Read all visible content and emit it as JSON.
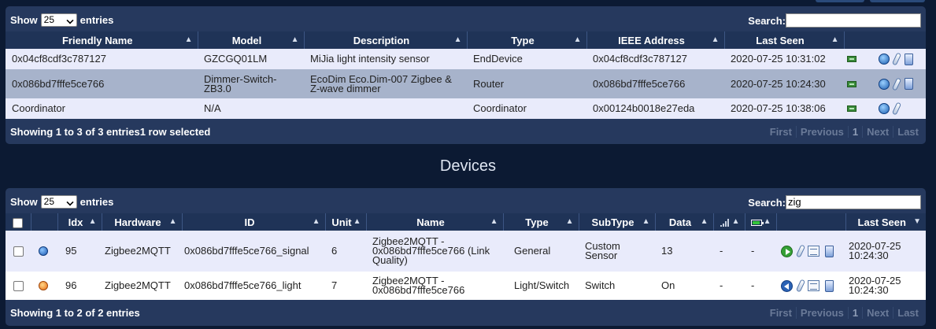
{
  "nodes_table": {
    "show_label": "Show",
    "entries_value": "25",
    "entries_label": "entries",
    "search_label": "Search:",
    "search_value": "",
    "columns": [
      "Friendly Name",
      "Model",
      "Description",
      "Type",
      "IEEE Address",
      "Last Seen"
    ],
    "rows": [
      {
        "friendly_name": "0x04cf8cdf3c787127",
        "model": "GZCGQ01LM",
        "description": "MiJia light intensity sensor",
        "type": "EndDevice",
        "ieee": "0x04cf8cdf3c787127",
        "last_seen": "2020-07-25 10:31:02"
      },
      {
        "friendly_name": "0x086bd7fffe5ce766",
        "model": "Dimmer-Switch-ZB3.0",
        "description": "EcoDim Eco.Dim-007 Zigbee & Z-wave dimmer",
        "type": "Router",
        "ieee": "0x086bd7fffe5ce766",
        "last_seen": "2020-07-25 10:24:30"
      },
      {
        "friendly_name": "Coordinator",
        "model": "N/A",
        "description": "",
        "type": "Coordinator",
        "ieee": "0x00124b0018e27eda",
        "last_seen": "2020-07-25 10:38:06"
      }
    ],
    "info": "Showing 1 to 3 of 3 entries1 row selected",
    "pager": {
      "first": "First",
      "previous": "Previous",
      "page": "1",
      "next": "Next",
      "last": "Last"
    }
  },
  "section_title": "Devices",
  "devices_table": {
    "show_label": "Show",
    "entries_value": "25",
    "entries_label": "entries",
    "search_label": "Search:",
    "search_value": "zig",
    "columns": [
      "Idx",
      "Hardware",
      "ID",
      "Unit",
      "Name",
      "Type",
      "SubType",
      "Data",
      "Last Seen"
    ],
    "rows": [
      {
        "idx": "95",
        "hardware": "Zigbee2MQTT",
        "id": "0x086bd7fffe5ce766_signal",
        "unit": "6",
        "name": "Zigbee2MQTT - 0x086bd7fffe5ce766 (Link Quality)",
        "type": "General",
        "subtype": "Custom Sensor",
        "data": "13",
        "signal": "-",
        "battery": "-",
        "last_seen": "2020-07-25 10:24:30",
        "icon": "globe-icon"
      },
      {
        "idx": "96",
        "hardware": "Zigbee2MQTT",
        "id": "0x086bd7fffe5ce766_light",
        "unit": "7",
        "name": "Zigbee2MQTT - 0x086bd7fffe5ce766",
        "type": "Light/Switch",
        "subtype": "Switch",
        "data": "On",
        "signal": "-",
        "battery": "-",
        "last_seen": "2020-07-25 10:24:30",
        "icon": "bulb-icon"
      }
    ],
    "info": "Showing 1 to 2 of 2 entries",
    "pager": {
      "first": "First",
      "previous": "Previous",
      "page": "1",
      "next": "Next",
      "last": "Last"
    }
  }
}
